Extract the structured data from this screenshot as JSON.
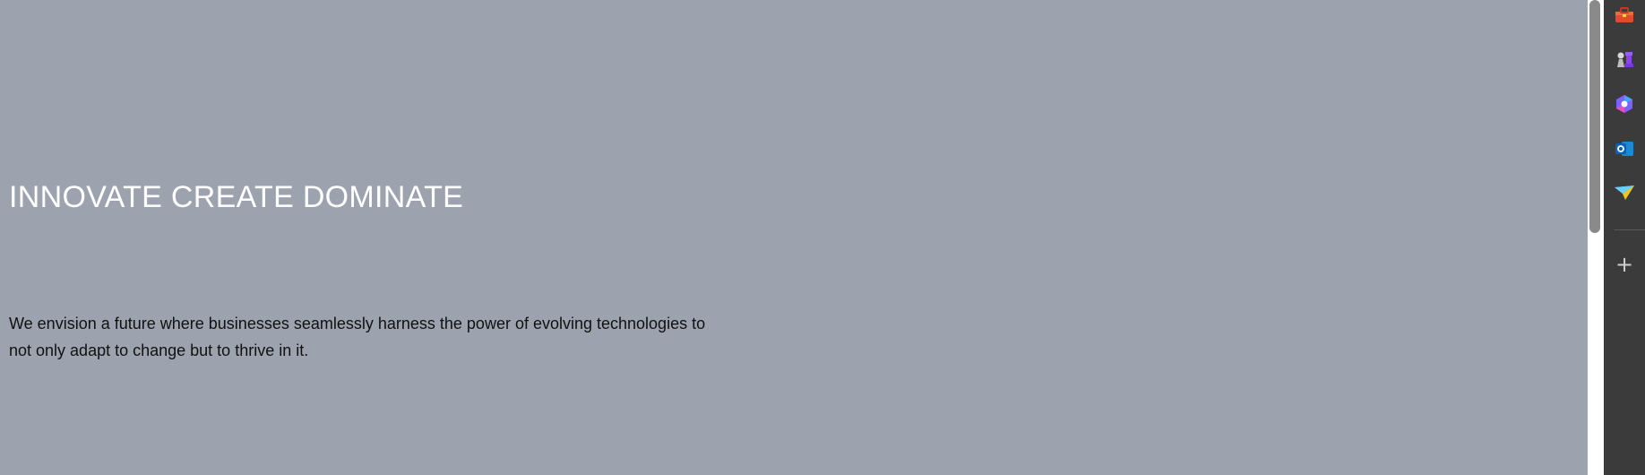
{
  "hero": {
    "title": "INNOVATE CREATE DOMINATE",
    "description": "We envision a future where businesses seamlessly harness the power of evolving technologies to not only adapt to change but to thrive in it."
  },
  "sidebar": {
    "items": [
      {
        "icon": "toolbox-icon"
      },
      {
        "icon": "chess-icon"
      },
      {
        "icon": "copilot-icon"
      },
      {
        "icon": "outlook-icon"
      },
      {
        "icon": "send-icon"
      }
    ],
    "add_label": "+"
  },
  "colors": {
    "hero_background": "#9ca3ae",
    "title_color": "#ffffff",
    "text_color": "#111111",
    "sidebar_background": "#3b3b3b"
  }
}
